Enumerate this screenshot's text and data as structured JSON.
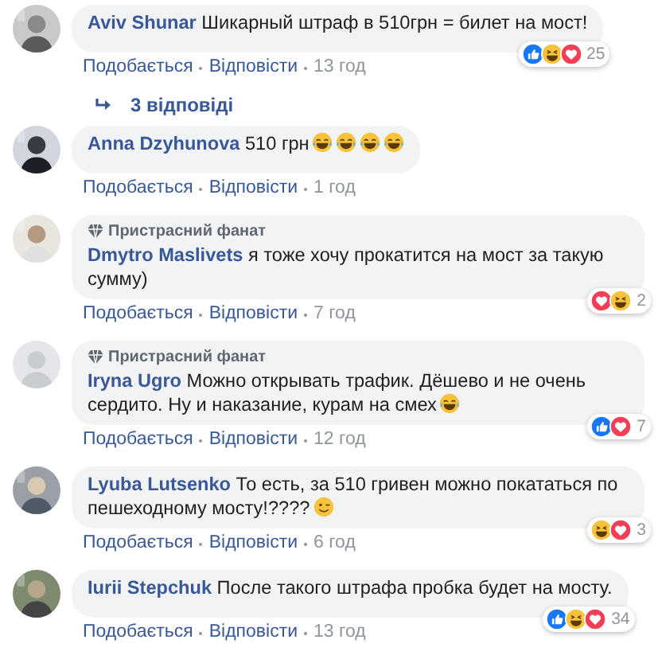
{
  "comments": [
    {
      "avatar": {
        "kind": "picture"
      },
      "author": "Aviv Shunar",
      "text": "Шикарный штраф в 510грн = билет на мост!",
      "reactions": {
        "kinds": [
          {
            "kind": "like"
          },
          {
            "kind": "haha"
          },
          {
            "kind": "love"
          }
        ],
        "count": "25"
      },
      "actions": {
        "like": "Подобається",
        "reply": "Відповісти",
        "time": "13 год"
      },
      "replies": "3 відповіді"
    },
    {
      "avatar": {
        "kind": "picture"
      },
      "author": "Anna Dzyhunova",
      "text": "510 грн",
      "emojis": [
        {
          "kind": "laugh"
        },
        {
          "kind": "laugh"
        },
        {
          "kind": "laugh"
        },
        {
          "kind": "laugh"
        }
      ],
      "actions": {
        "like": "Подобається",
        "reply": "Відповісти",
        "time": "1 год"
      }
    },
    {
      "avatar": {
        "kind": "picture"
      },
      "badge": "Пристрасний фанат",
      "author": "Dmytro Maslivets",
      "text": "я тоже хочу прокатится на мост за такую сумму)",
      "reactions": {
        "kinds": [
          {
            "kind": "love"
          },
          {
            "kind": "haha"
          }
        ],
        "count": "2"
      },
      "actions": {
        "like": "Подобається",
        "reply": "Відповісти",
        "time": "7 год"
      }
    },
    {
      "avatar": {
        "kind": "blank"
      },
      "badge": "Пристрасний фанат",
      "author": "Iryna Ugro",
      "text": "Можно открывать трафик. Дёшево и не очень сердито. Ну и наказание, курам на смех",
      "emojis": [
        {
          "kind": "laugh"
        }
      ],
      "reactions": {
        "kinds": [
          {
            "kind": "like"
          },
          {
            "kind": "love"
          }
        ],
        "count": "7"
      },
      "actions": {
        "like": "Подобається",
        "reply": "Відповісти",
        "time": "12 год"
      }
    },
    {
      "avatar": {
        "kind": "picture"
      },
      "author": "Lyuba Lutsenko",
      "text": "То есть, за 510 гривен можно покататься по пешеходному мосту!????",
      "emojis": [
        {
          "kind": "wink"
        }
      ],
      "reactions": {
        "kinds": [
          {
            "kind": "haha"
          },
          {
            "kind": "love"
          }
        ],
        "count": "3"
      },
      "actions": {
        "like": "Подобається",
        "reply": "Відповісти",
        "time": "6 год"
      }
    },
    {
      "avatar": {
        "kind": "picture"
      },
      "author": "Iurii Stepchuk",
      "text": "После такого штрафа пробка будет на мосту.",
      "reactions": {
        "kinds": [
          {
            "kind": "like"
          },
          {
            "kind": "haha"
          },
          {
            "kind": "love"
          }
        ],
        "count": "34"
      },
      "actions": {
        "like": "Подобається",
        "reply": "Відповісти",
        "time": "13 год"
      }
    }
  ]
}
